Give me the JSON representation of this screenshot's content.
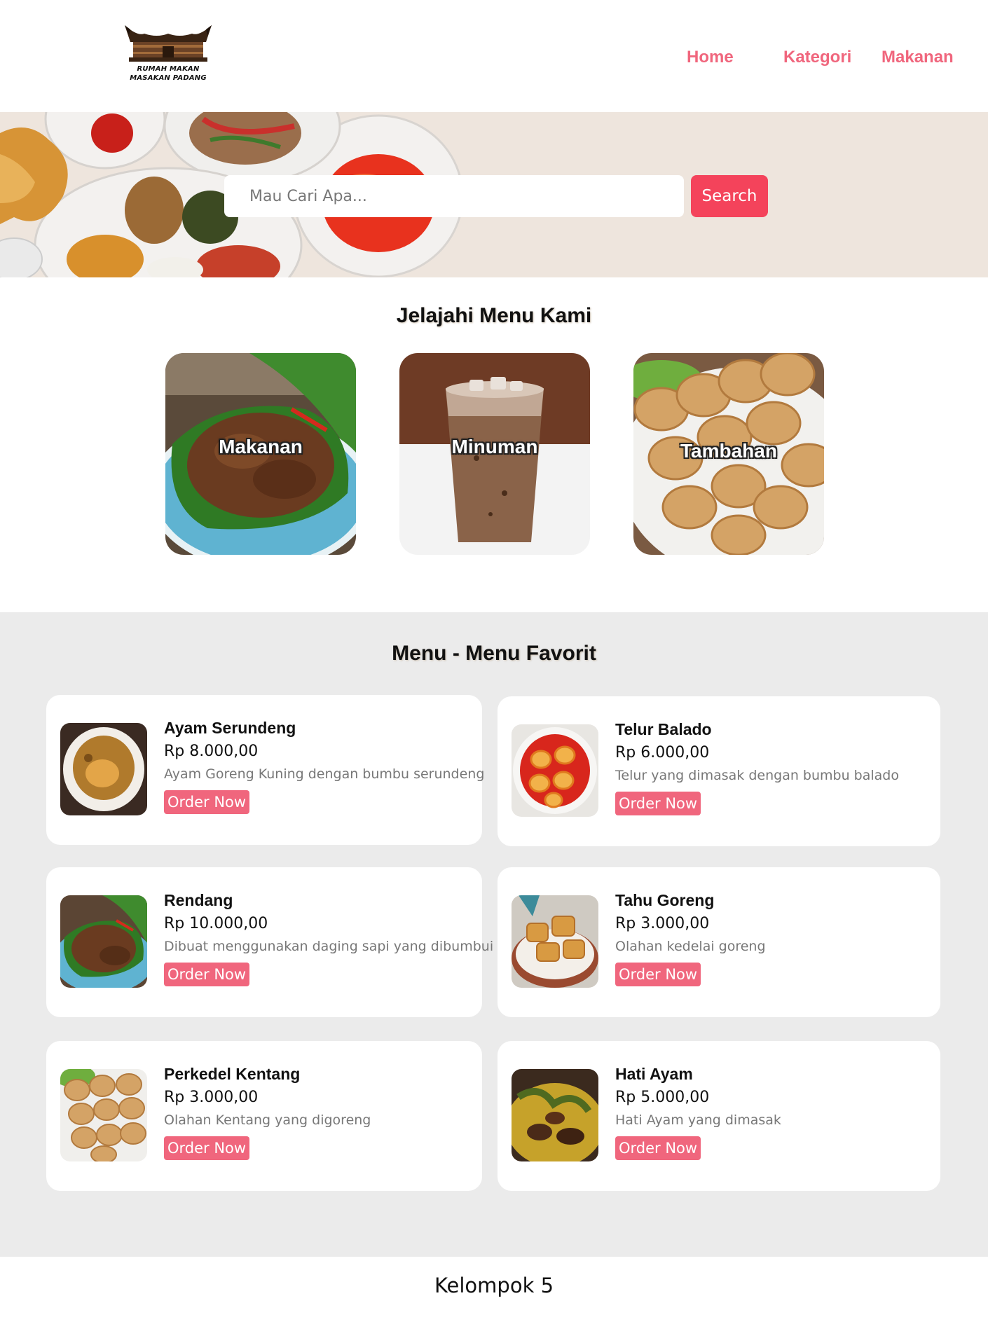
{
  "header": {
    "logo_text_line1": "RUMAH MAKAN",
    "logo_text_line2": "MASAKAN PADANG",
    "nav": [
      {
        "label": "Home"
      },
      {
        "label": "Kategori"
      },
      {
        "label": "Makanan"
      }
    ]
  },
  "search": {
    "placeholder": "Mau Cari Apa...",
    "button_label": "Search"
  },
  "categories": {
    "title": "Jelajahi Menu Kami",
    "items": [
      {
        "label": "Makanan"
      },
      {
        "label": "Minuman"
      },
      {
        "label": "Tambahan"
      }
    ]
  },
  "favorites": {
    "title": "Menu - Menu Favorit",
    "order_label": "Order Now",
    "items": [
      {
        "name": "Ayam Serundeng",
        "price": "Rp 8.000,00",
        "desc": "Ayam Goreng Kuning dengan bumbu serundeng"
      },
      {
        "name": "Telur Balado",
        "price": "Rp 6.000,00",
        "desc": "Telur yang dimasak dengan bumbu balado"
      },
      {
        "name": "Rendang",
        "price": "Rp 10.000,00",
        "desc": "Dibuat menggunakan daging sapi yang dibumbui"
      },
      {
        "name": "Tahu Goreng",
        "price": "Rp 3.000,00",
        "desc": "Olahan kedelai goreng"
      },
      {
        "name": "Perkedel Kentang",
        "price": "Rp 3.000,00",
        "desc": "Olahan Kentang yang digoreng"
      },
      {
        "name": "Hati Ayam",
        "price": "Rp 5.000,00",
        "desc": "Hati Ayam yang dimasak"
      }
    ]
  },
  "footer": {
    "text": "Kelompok 5"
  },
  "colors": {
    "accent_pink": "#f0667d",
    "search_red": "#f4435b",
    "hero_bg": "#eee5dd",
    "favorites_bg": "#ebebeb"
  }
}
